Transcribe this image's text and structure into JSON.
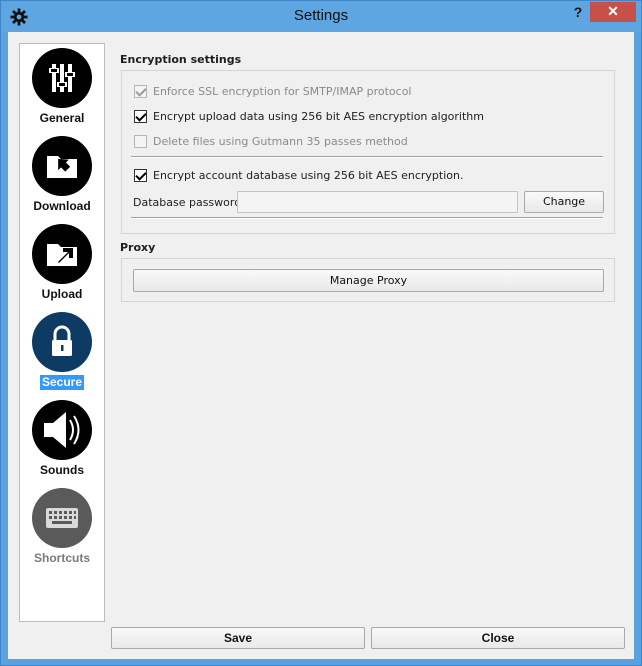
{
  "window": {
    "title": "Settings",
    "help_label": "?",
    "close_label": "✕",
    "app_icon": "gear-icon"
  },
  "sidebar": {
    "items": [
      {
        "label": "General",
        "icon": "sliders-icon",
        "state": "normal"
      },
      {
        "label": "Download",
        "icon": "folder-download-icon",
        "state": "normal"
      },
      {
        "label": "Upload",
        "icon": "folder-upload-icon",
        "state": "normal"
      },
      {
        "label": "Secure",
        "icon": "lock-icon",
        "state": "selected"
      },
      {
        "label": "Sounds",
        "icon": "speaker-icon",
        "state": "normal"
      },
      {
        "label": "Shortcuts",
        "icon": "keyboard-icon",
        "state": "disabled"
      }
    ]
  },
  "encryption": {
    "title": "Encryption settings",
    "ssl": {
      "label": "Enforce SSL encryption for SMTP/IMAP protocol",
      "checked": true,
      "enabled": false
    },
    "upload_aes": {
      "label": "Encrypt upload data using 256 bit AES encryption algorithm",
      "checked": true,
      "enabled": true
    },
    "gutmann": {
      "label": "Delete files using Gutmann 35 passes method",
      "checked": false,
      "enabled": false
    },
    "account_db": {
      "label": "Encrypt account database using 256 bit AES encryption.",
      "checked": true,
      "enabled": true
    },
    "password_label": "Database  password",
    "password_value": "",
    "change_label": "Change"
  },
  "proxy": {
    "title": "Proxy",
    "manage_label": "Manage Proxy"
  },
  "footer": {
    "save_label": "Save",
    "close_label": "Close"
  },
  "colors": {
    "title_bar": "#5ea6e1",
    "close_button": "#c7504b",
    "selection": "#3399ff",
    "selected_icon": "#0e3b64"
  }
}
